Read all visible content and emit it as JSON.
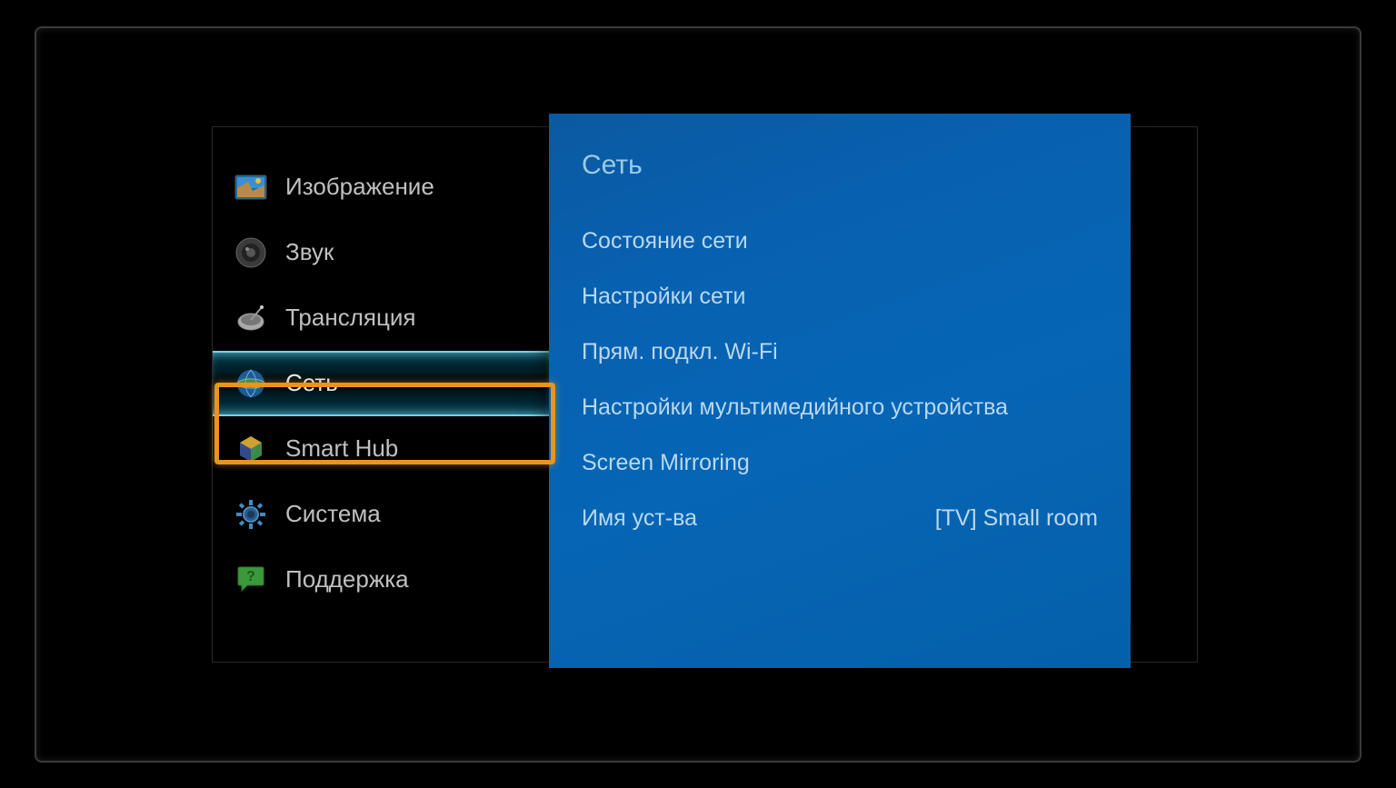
{
  "sidebar": {
    "items": [
      {
        "label": "Изображение",
        "icon": "picture"
      },
      {
        "label": "Звук",
        "icon": "sound"
      },
      {
        "label": "Трансляция",
        "icon": "broadcast"
      },
      {
        "label": "Сеть",
        "icon": "network",
        "selected": true
      },
      {
        "label": "Smart Hub",
        "icon": "smarthub"
      },
      {
        "label": "Система",
        "icon": "system"
      },
      {
        "label": "Поддержка",
        "icon": "support"
      }
    ]
  },
  "panel": {
    "title": "Сеть",
    "items": [
      {
        "label": "Состояние сети",
        "value": ""
      },
      {
        "label": "Настройки сети",
        "value": ""
      },
      {
        "label": "Прям. подкл. Wi-Fi",
        "value": ""
      },
      {
        "label": "Настройки мультимедийного устройства",
        "value": ""
      },
      {
        "label": "Screen Mirroring",
        "value": ""
      },
      {
        "label": "Имя уст-ва",
        "value": "[TV] Small room"
      }
    ]
  }
}
